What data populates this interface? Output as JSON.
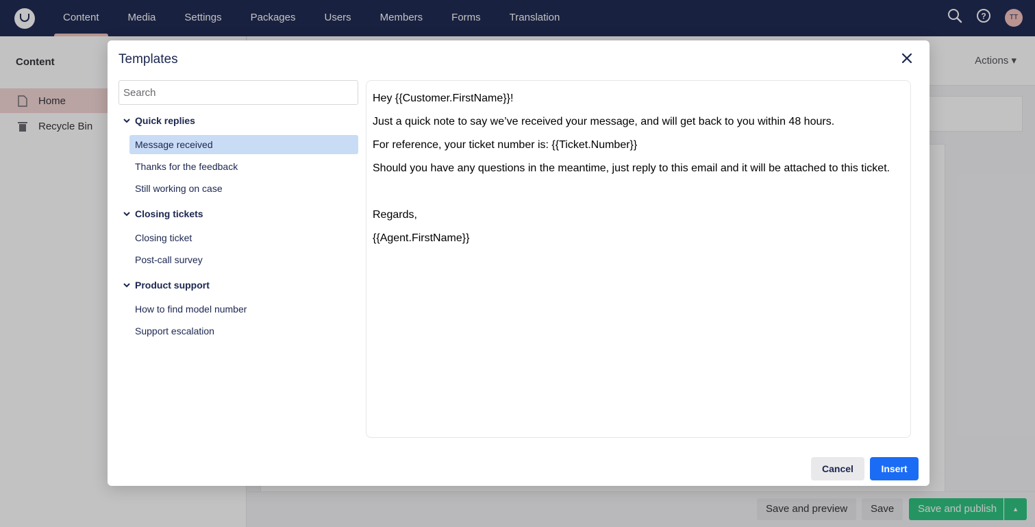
{
  "topbar": {
    "logo_icon": "umbraco-logo-icon",
    "nav": [
      "Content",
      "Media",
      "Settings",
      "Packages",
      "Users",
      "Members",
      "Forms",
      "Translation"
    ],
    "active_nav": "Content",
    "avatar_initials": "TT"
  },
  "sidebar": {
    "title": "Content",
    "items": [
      {
        "label": "Home",
        "icon": "document-icon"
      },
      {
        "label": "Recycle Bin",
        "icon": "trash-icon"
      }
    ]
  },
  "editor": {
    "actions_label": "Actions",
    "save_preview_label": "Save and preview",
    "save_label": "Save",
    "save_publish_label": "Save and publish"
  },
  "modal": {
    "title": "Templates",
    "search_placeholder": "Search",
    "groups": [
      {
        "label": "Quick replies",
        "items": [
          "Message received",
          "Thanks for the feedback",
          "Still working on case"
        ]
      },
      {
        "label": "Closing tickets",
        "items": [
          "Closing ticket",
          "Post-call survey"
        ]
      },
      {
        "label": "Product support",
        "items": [
          "How to find model number",
          "Support escalation"
        ]
      }
    ],
    "selected_item": "Message received",
    "preview_lines": [
      "Hey {{Customer.FirstName}}!",
      "Just a quick note to say we’ve received your message, and will get back to you within 48 hours.",
      "For reference, your ticket number is: {{Ticket.Number}}",
      "Should you have any questions in the meantime, just reply to this email and it will be attached to this ticket.",
      "",
      "Regards,",
      "{{Agent.FirstName}}"
    ],
    "cancel_label": "Cancel",
    "insert_label": "Insert"
  },
  "colors": {
    "header_bg": "#1b264f",
    "accent_pink": "#f5c1bc",
    "selected_bg": "#c9dcf5",
    "primary_button": "#1b6cf5",
    "publish_green": "#2bc37c"
  }
}
